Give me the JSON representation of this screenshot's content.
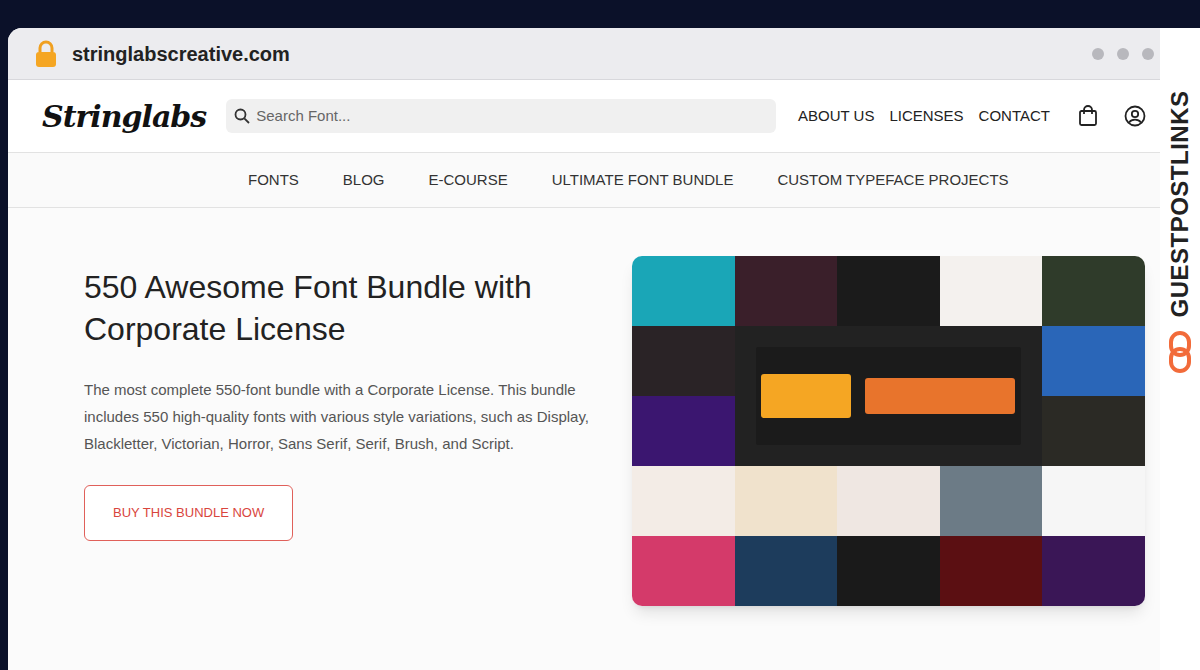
{
  "browser": {
    "url": "stringlabscreative.com"
  },
  "watermark": "GUESTPOSTLINKS",
  "site": {
    "logo": "Stringlabs",
    "search": {
      "placeholder": "Search Font..."
    },
    "top_nav": [
      "ABOUT US",
      "LICENSES",
      "CONTACT"
    ],
    "main_nav": [
      "FONTS",
      "BLOG",
      "E-COURSE",
      "ULTIMATE FONT BUNDLE",
      "CUSTOM TYPEFACE PROJECTS"
    ]
  },
  "hero": {
    "title": "550 Awesome Font Bundle with Corporate License",
    "description": "The most complete 550-font bundle with a Corporate License. This bundle includes 550 high-quality fonts with various style variations, such as Display, Blackletter, Victorian, Horror, Sans Serif, Serif, Brush, and Script.",
    "button": "BUY THIS BUNDLE NOW"
  }
}
